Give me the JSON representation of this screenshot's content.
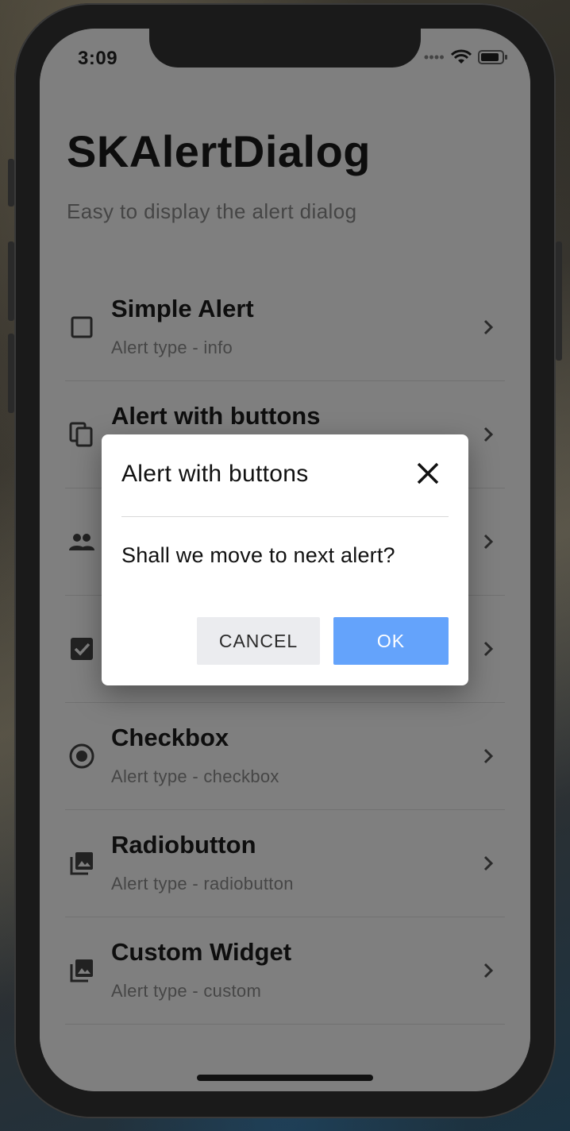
{
  "status_bar": {
    "time": "3:09"
  },
  "app": {
    "title": "SKAlertDialog",
    "subtitle": "Easy to display the alert dialog"
  },
  "list": [
    {
      "title": "Simple Alert",
      "subtitle": "Alert type - info",
      "icon": "checkbox-blank-icon"
    },
    {
      "title": "Alert with buttons",
      "subtitle": "",
      "icon": "copy-icon"
    },
    {
      "title": "",
      "subtitle": "",
      "icon": "people-icon"
    },
    {
      "title": "",
      "subtitle": "",
      "icon": "checkbox-checked-icon"
    },
    {
      "title": "Checkbox",
      "subtitle": "Alert type - checkbox",
      "icon": "radio-button-icon"
    },
    {
      "title": "Radiobutton",
      "subtitle": "Alert type - radiobutton",
      "icon": "photo-library-icon"
    },
    {
      "title": "Custom Widget",
      "subtitle": "Alert type - custom",
      "icon": "photo-library-icon"
    }
  ],
  "dialog": {
    "title": "Alert with buttons",
    "message": "Shall we move to next alert?",
    "cancel_label": "CANCEL",
    "ok_label": "OK"
  },
  "colors": {
    "ok_button": "#64a3fb",
    "cancel_button": "#ebecef",
    "scrim": "rgba(0,0,0,0.5)"
  }
}
